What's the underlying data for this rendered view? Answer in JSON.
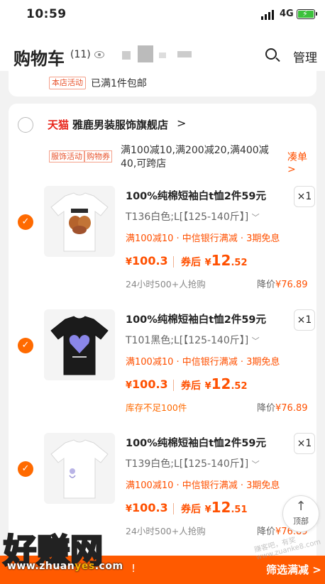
{
  "status": {
    "time": "10:59",
    "network": "4G"
  },
  "header": {
    "title": "购物车",
    "count": "(11)",
    "manage": "管理"
  },
  "store_activity": {
    "tag": "本店活动",
    "text": "已满1件包邮"
  },
  "shop": {
    "platform": "天猫",
    "name": "雅鹿男装服饰旗舰店",
    "arrow": ">",
    "promo_tags": [
      "服饰活动",
      "购物券"
    ],
    "promo_text": "满100减10,满200减20,满400减40,可跨店",
    "coudan": "凑单 >"
  },
  "items": [
    {
      "title": "100%纯棉短袖白t恤2件59元",
      "qty": "×1",
      "sku": "T136白色;L[【125-140斤】]",
      "discount": "满100减10 · 中信银行满减 · 3期免息",
      "price_currency": "¥",
      "price": "100.3",
      "after_label": "券后",
      "after_currency": "¥",
      "after_int": "12",
      "after_dec": ".52",
      "note": "24小时500+人抢购",
      "drop_label": "降价",
      "drop_value": "¥76.89",
      "shirt_color": "#ffffff"
    },
    {
      "title": "100%纯棉短袖白t恤2件59元",
      "qty": "×1",
      "sku": "T101黑色;L[【125-140斤】]",
      "discount": "满100减10 · 中信银行满减 · 3期免息",
      "price_currency": "¥",
      "price": "100.3",
      "after_label": "券后",
      "after_currency": "¥",
      "after_int": "12",
      "after_dec": ".52",
      "note": "库存不足100件",
      "drop_label": "降价",
      "drop_value": "¥76.89",
      "shirt_color": "#1b1b1b"
    },
    {
      "title": "100%纯棉短袖白t恤2件59元",
      "qty": "×1",
      "sku": "T139白色;L[【125-140斤】]",
      "discount": "满100减10 · 中信银行满减 · 3期免息",
      "price_currency": "¥",
      "price": "100.3",
      "after_label": "券后",
      "after_currency": "¥",
      "after_int": "12",
      "after_dec": ".51",
      "note": "24小时500+人抢购",
      "drop_label": "降价",
      "drop_value": "¥76.89",
      "shirt_color": "#ffffff"
    }
  ],
  "back_top": {
    "label": "顶部"
  },
  "bottom": {
    "filter": "筛选满减 >",
    "exclaim": "!"
  },
  "watermark": {
    "big": "好赚网",
    "url_a": "www.zhuan",
    "url_b": "yes",
    "url_c": ".com",
    "side": "赚客吧，有奖 www.zuanke8.com"
  },
  "colors": {
    "accent": "#ff5000",
    "tmall": "#e8251b",
    "check": "#ff6a00"
  }
}
